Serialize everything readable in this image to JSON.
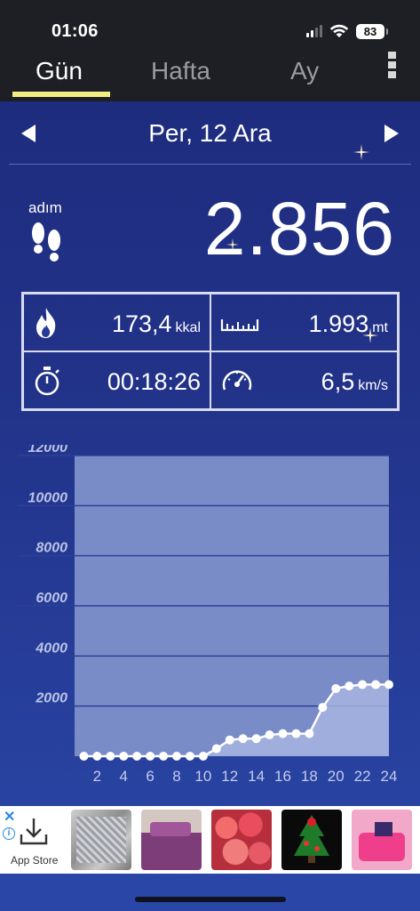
{
  "status": {
    "time": "01:06",
    "battery": "83"
  },
  "tabs": [
    {
      "label": "Gün",
      "active": true
    },
    {
      "label": "Hafta",
      "active": false
    },
    {
      "label": "Ay",
      "active": false
    }
  ],
  "date": {
    "label": "Per, 12 Ara"
  },
  "steps": {
    "label": "adım",
    "count": "2.856"
  },
  "stats": {
    "calories": {
      "value": "173,4",
      "unit": "kkal",
      "icon": "fire-icon"
    },
    "distance": {
      "value": "1.993",
      "unit": "mt",
      "icon": "ruler-icon"
    },
    "duration": {
      "value": "00:18:26",
      "icon": "stopwatch-icon"
    },
    "speed": {
      "value": "6,5",
      "unit": "km/s",
      "icon": "speedometer-icon"
    }
  },
  "chart_data": {
    "type": "line",
    "x": [
      1,
      2,
      3,
      4,
      5,
      6,
      7,
      8,
      9,
      10,
      11,
      12,
      13,
      14,
      15,
      16,
      17,
      18,
      19,
      20,
      21,
      22,
      23,
      24
    ],
    "x_tick_labels": [
      "2",
      "4",
      "6",
      "8",
      "10",
      "12",
      "14",
      "16",
      "18",
      "20",
      "22",
      "24"
    ],
    "y_tick_labels": [
      "2000",
      "4000",
      "6000",
      "8000",
      "10000",
      "12000"
    ],
    "series": [
      {
        "values": [
          0,
          0,
          0,
          0,
          0,
          0,
          0,
          0,
          0,
          0,
          300,
          650,
          700,
          700,
          850,
          900,
          900,
          900,
          1950,
          2700,
          2800,
          2856,
          2856,
          2856
        ]
      }
    ],
    "ylim": [
      0,
      12000
    ],
    "xlim": [
      0.3,
      24
    ],
    "grid": true,
    "colors": {
      "plot_bg": "#7a8cc8",
      "line": "#ffffff",
      "gridline": "#2f3f96"
    }
  },
  "ad": {
    "store_label": "App Store",
    "close_label": "✕",
    "info_label": "i",
    "thumbnails": [
      "gray-knit-blanket",
      "purple-bedspread",
      "pink-roses",
      "christmas-tree",
      "pink-pillows"
    ]
  }
}
